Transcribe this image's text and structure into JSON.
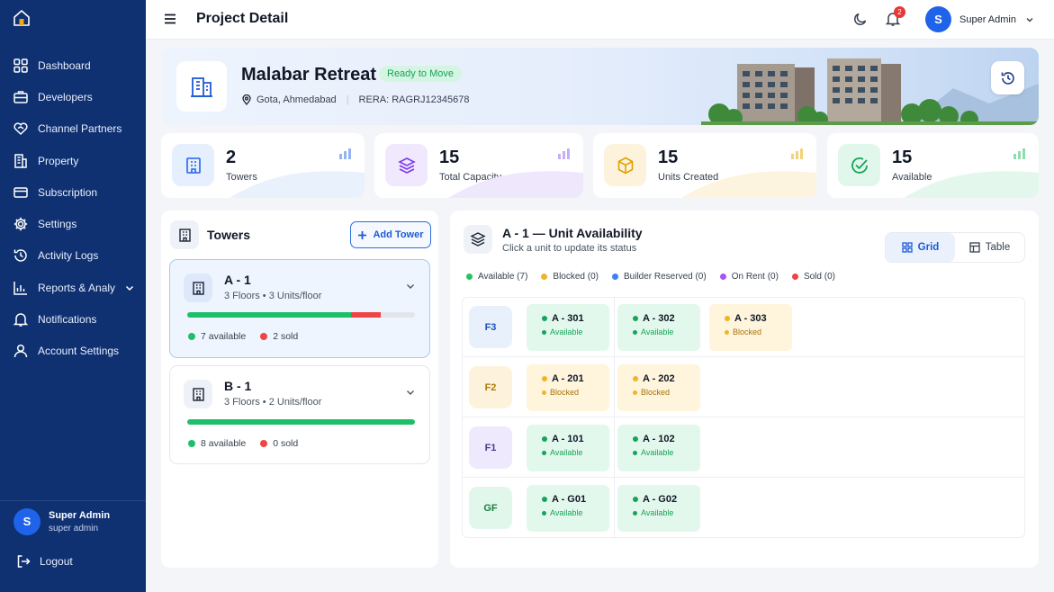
{
  "sidebar": {
    "items": [
      {
        "label": "Dashboard",
        "icon": "dashboard-icon"
      },
      {
        "label": "Developers",
        "icon": "briefcase-icon"
      },
      {
        "label": "Channel Partners",
        "icon": "handshake-icon"
      },
      {
        "label": "Property",
        "icon": "building-icon"
      },
      {
        "label": "Subscription",
        "icon": "card-icon"
      },
      {
        "label": "Settings",
        "icon": "gear-icon"
      },
      {
        "label": "Activity Logs",
        "icon": "history-icon"
      },
      {
        "label": "Reports & Analy",
        "icon": "chart-icon"
      },
      {
        "label": "Notifications",
        "icon": "bell-icon"
      },
      {
        "label": "Account Settings",
        "icon": "user-icon"
      }
    ],
    "user": {
      "initial": "S",
      "name": "Super Admin",
      "role": "super admin"
    },
    "logout": "Logout"
  },
  "topbar": {
    "title": "Project Detail",
    "notif_count": "2",
    "user_initial": "S",
    "user_name": "Super Admin"
  },
  "hero": {
    "name": "Malabar Retreat",
    "status": "Ready to Move",
    "location": "Gota, Ahmedabad",
    "rera_label": "RERA:",
    "rera": "RAGRJ12345678"
  },
  "stats": [
    {
      "value": "2",
      "label": "Towers",
      "color": "#3b82f6"
    },
    {
      "value": "15",
      "label": "Total Capacity",
      "color": "#7c3aed"
    },
    {
      "value": "15",
      "label": "Units Created",
      "color": "#eab308"
    },
    {
      "value": "15",
      "label": "Available",
      "color": "#22c55e"
    }
  ],
  "towers": {
    "title": "Towers",
    "add_label": "Add Tower",
    "list": [
      {
        "name": "A - 1",
        "sub": "3 Floors • 3 Units/floor",
        "available": "7 available",
        "sold": "2 sold",
        "avail_frac": 0.72,
        "sold_frac": 0.13
      },
      {
        "name": "B - 1",
        "sub": "3 Floors • 2 Units/floor",
        "available": "8 available",
        "sold": "0 sold",
        "avail_frac": 1.0,
        "sold_frac": 0.0
      }
    ]
  },
  "availability": {
    "title": "A - 1 — Unit Availability",
    "subtitle": "Click a unit to update its status",
    "view_grid": "Grid",
    "view_table": "Table",
    "legend": [
      {
        "label": "Available (7)",
        "color": "#22c55e"
      },
      {
        "label": "Blocked (0)",
        "color": "#f0b429"
      },
      {
        "label": "Builder Reserved (0)",
        "color": "#3b82f6"
      },
      {
        "label": "On Rent (0)",
        "color": "#a855f7"
      },
      {
        "label": "Sold (0)",
        "color": "#ef4444"
      }
    ],
    "floors": [
      {
        "label": "F3",
        "units": [
          {
            "name": "A - 301",
            "status": "Available",
            "kind": "available"
          },
          {
            "name": "A - 302",
            "status": "Available",
            "kind": "available"
          },
          {
            "name": "A - 303",
            "status": "Blocked",
            "kind": "blocked"
          }
        ]
      },
      {
        "label": "F2",
        "units": [
          {
            "name": "A - 201",
            "status": "Blocked",
            "kind": "blocked"
          },
          {
            "name": "A - 202",
            "status": "Blocked",
            "kind": "blocked"
          }
        ]
      },
      {
        "label": "F1",
        "units": [
          {
            "name": "A - 101",
            "status": "Available",
            "kind": "available"
          },
          {
            "name": "A - 102",
            "status": "Available",
            "kind": "available"
          }
        ]
      },
      {
        "label": "GF",
        "units": [
          {
            "name": "A - G01",
            "status": "Available",
            "kind": "available"
          },
          {
            "name": "A - G02",
            "status": "Available",
            "kind": "available"
          }
        ]
      }
    ]
  }
}
